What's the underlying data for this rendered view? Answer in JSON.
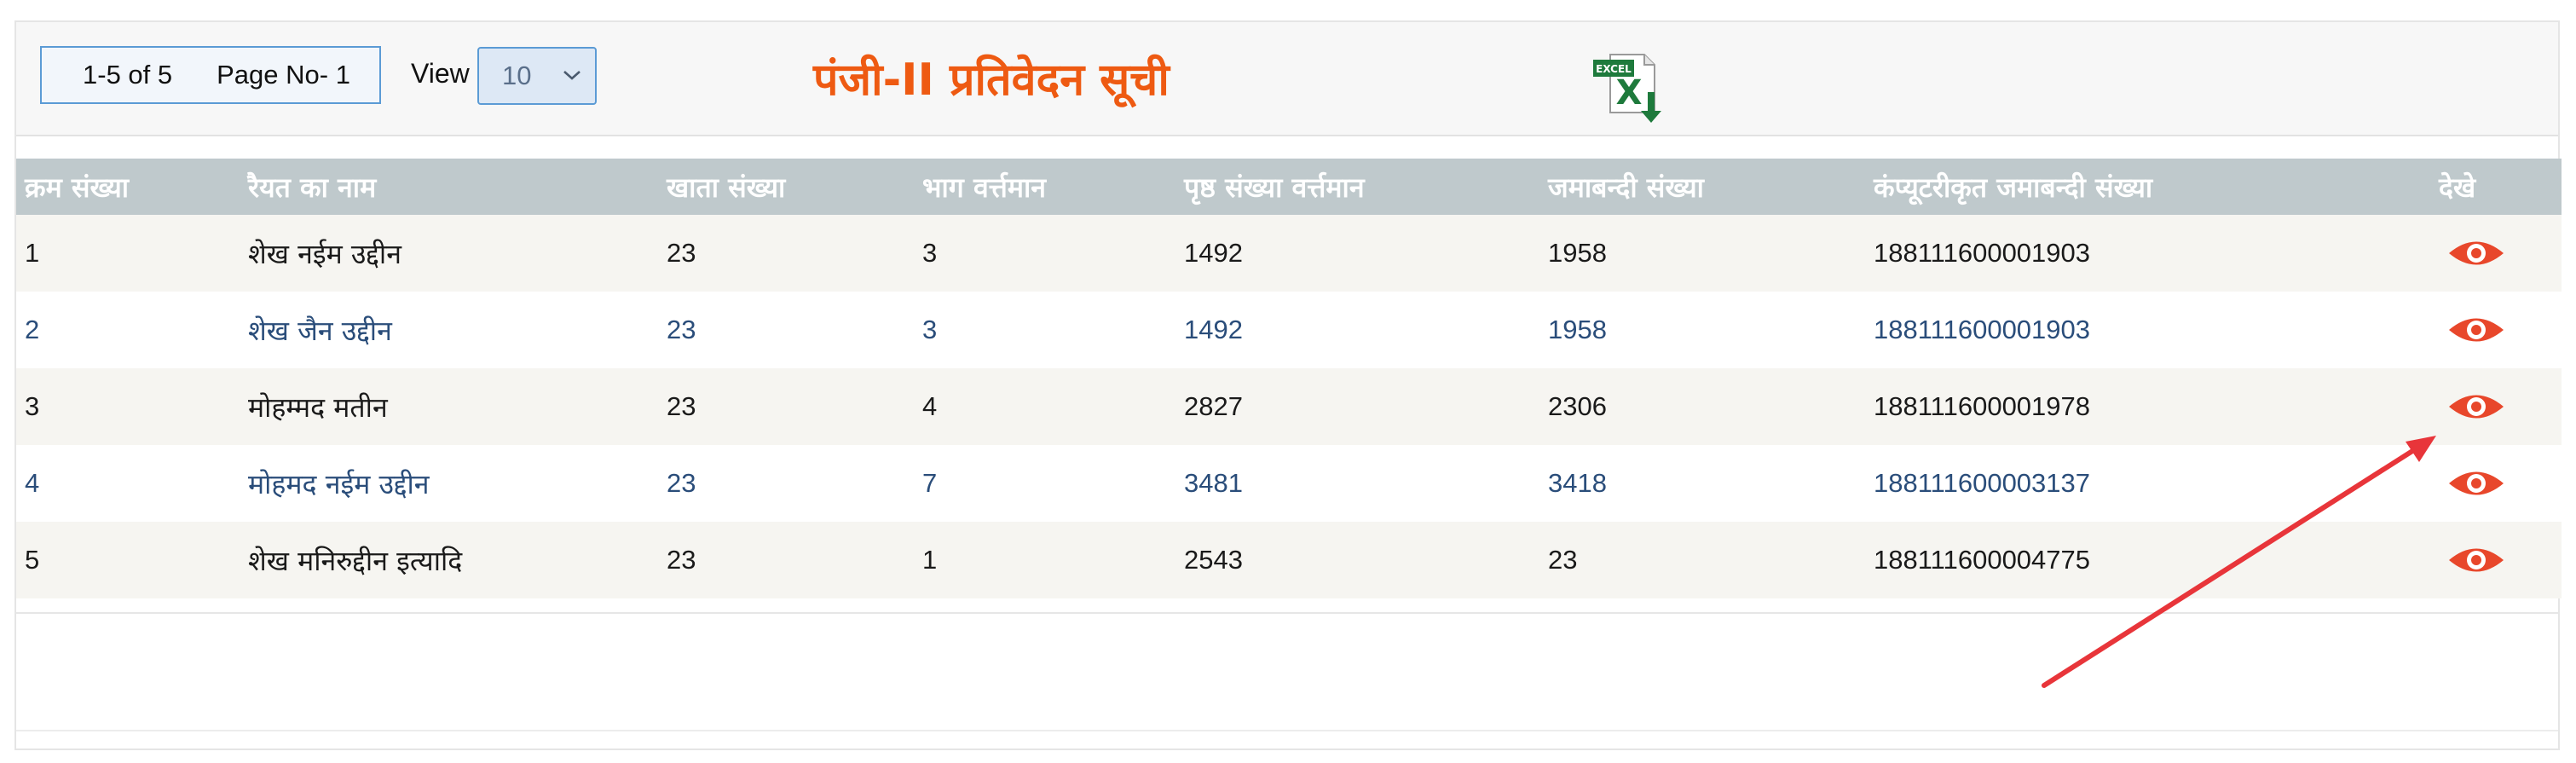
{
  "toolbar": {
    "pager_range": "1-5 of 5",
    "pager_page": "Page No- 1",
    "view_label": "View",
    "view_value": "10",
    "title": "पंजी-II प्रतिवेदन सूची",
    "excel_badge": "EXCEL",
    "excel_icon": "excel-export-icon"
  },
  "table": {
    "headers": [
      "क्रम संख्या",
      "रैयत का नाम",
      "खाता संख्या",
      "भाग वर्त्तमान",
      "पृष्ठ संख्या वर्त्तमान",
      "जमाबन्दी संख्या",
      "कंप्यूटरीकृत जमाबन्दी संख्या",
      "देखे"
    ],
    "rows": [
      {
        "sn": "1",
        "name": "शेख नईम उद्दीन",
        "khata": "23",
        "bhag": "3",
        "prishth": "1492",
        "jamabandi": "1958",
        "computerized": "188111600001903"
      },
      {
        "sn": "2",
        "name": "शेख जैन उद्दीन",
        "khata": "23",
        "bhag": "3",
        "prishth": "1492",
        "jamabandi": "1958",
        "computerized": "188111600001903"
      },
      {
        "sn": "3",
        "name": "मोहम्मद मतीन",
        "khata": "23",
        "bhag": "4",
        "prishth": "2827",
        "jamabandi": "2306",
        "computerized": "188111600001978"
      },
      {
        "sn": "4",
        "name": "मोहमद नईम उद्दीन",
        "khata": "23",
        "bhag": "7",
        "prishth": "3481",
        "jamabandi": "3418",
        "computerized": "188111600003137"
      },
      {
        "sn": "5",
        "name": "शेख मनिरुद्दीन इत्यादि",
        "khata": "23",
        "bhag": "1",
        "prishth": "2543",
        "jamabandi": "23",
        "computerized": "188111600004775"
      }
    ]
  },
  "colors": {
    "title": "#ee5a12",
    "header_bg": "#bfc9cc",
    "eye_icon": "#e8472b",
    "annotation_arrow": "#e8353a",
    "link_text": "#2a4d7a"
  }
}
